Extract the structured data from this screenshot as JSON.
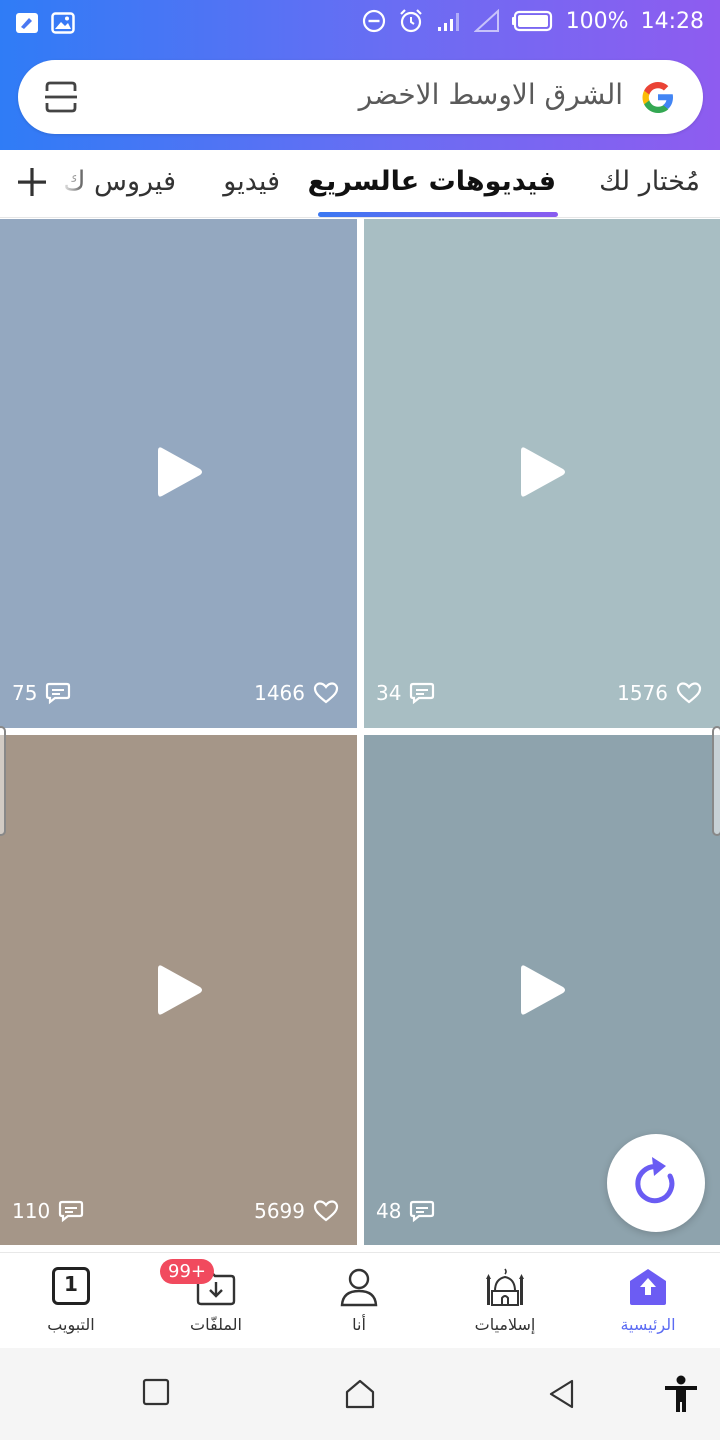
{
  "status_bar": {
    "battery": "100%",
    "time": "14:28"
  },
  "search": {
    "query": "الشرق الاوسط الاخضر"
  },
  "tabs": [
    {
      "label": "مُختار لك",
      "active": false
    },
    {
      "label": "فيديوهات عالسريع",
      "active": true
    },
    {
      "label": "فيديو",
      "active": false
    },
    {
      "label": "فيروس ك",
      "active": false
    }
  ],
  "cards": [
    {
      "likes": "1466",
      "comments": "75",
      "color": "#94a8c0"
    },
    {
      "likes": "1576",
      "comments": "34",
      "color": "#a8bec3"
    },
    {
      "likes": "5699",
      "comments": "110",
      "color": "#a59688"
    },
    {
      "likes": "",
      "comments": "48",
      "color": "#8ea3ad"
    }
  ],
  "bottom_nav": [
    {
      "label": "الرئيسية",
      "icon": "home-arrow-icon",
      "active": true
    },
    {
      "label": "إسلاميات",
      "icon": "mosque-icon",
      "active": false
    },
    {
      "label": "أنا",
      "icon": "person-icon",
      "active": false
    },
    {
      "label": "الملفّات",
      "icon": "download-folder-icon",
      "active": false,
      "badge": "99+"
    },
    {
      "label": "التبويب",
      "icon": "tabs-count-icon",
      "active": false,
      "count": "1"
    }
  ],
  "colors": {
    "accent": "#5b6bf3",
    "gradient_start": "#2f7cf6",
    "gradient_end": "#8e5cf0",
    "badge": "#f14a5e"
  }
}
